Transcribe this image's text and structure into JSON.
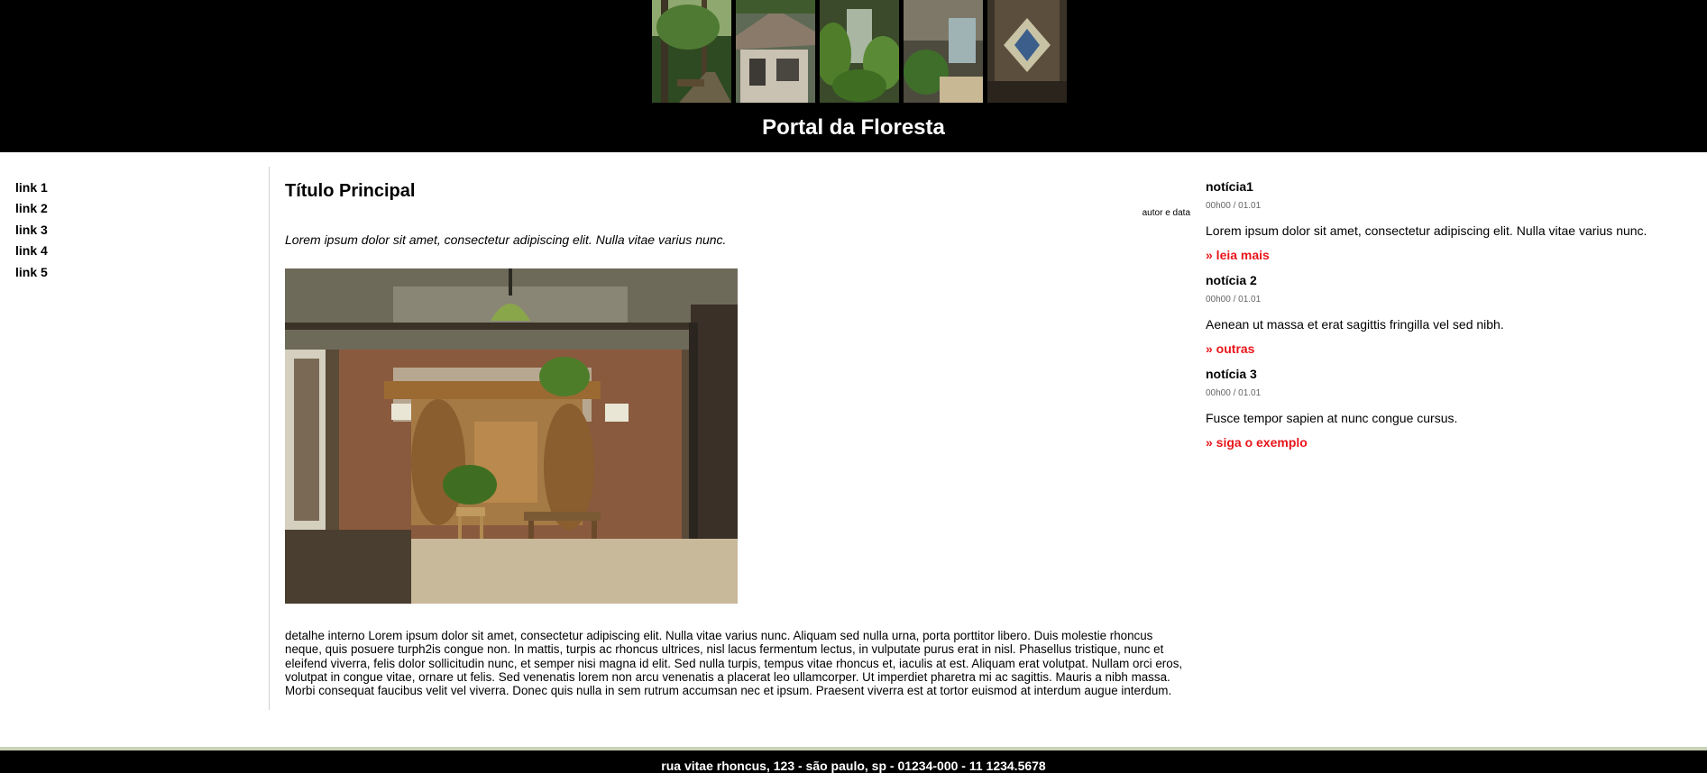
{
  "header": {
    "title": "Portal da Floresta"
  },
  "nav": {
    "links": [
      "link 1",
      "link 2",
      "link 3",
      "link 4",
      "link 5"
    ]
  },
  "article": {
    "title": "Título Principal",
    "author_date": "autor e data",
    "lead": "Lorem ipsum dolor sit amet, consectetur adipiscing elit. Nulla vitae varius nunc.",
    "body": "detalhe interno Lorem ipsum dolor sit amet, consectetur adipiscing elit. Nulla vitae varius nunc. Aliquam sed nulla urna, porta porttitor libero. Duis molestie rhoncus neque, quis posuere turph2is congue non. In mattis, turpis ac rhoncus ultrices, nisl lacus fermentum lectus, in vulputate purus erat in nisl. Phasellus tristique, nunc et eleifend viverra, felis dolor sollicitudin nunc, et semper nisi magna id elit. Sed nulla turpis, tempus vitae rhoncus et, iaculis at est. Aliquam erat volutpat. Nullam orci eros, volutpat in congue vitae, ornare ut felis. Sed venenatis lorem non arcu venenatis a placerat leo ullamcorper. Ut imperdiet pharetra mi ac sagittis. Mauris a nibh massa. Morbi consequat faucibus velit vel viverra. Donec quis nulla in sem rutrum accumsan nec et ipsum. Praesent viverra est at tortor euismod at interdum augue interdum."
  },
  "news": [
    {
      "title": "notícia1",
      "date": "00h00 / 01.01",
      "text": "Lorem ipsum dolor sit amet, consectetur adipiscing elit. Nulla vitae varius nunc.",
      "link": "» leia mais"
    },
    {
      "title": "notícia 2",
      "date": "00h00 / 01.01",
      "text": "Aenean ut massa et erat sagittis fringilla vel sed nibh.",
      "link": "» outras"
    },
    {
      "title": "notícia 3",
      "date": "00h00 / 01.01",
      "text": "Fusce tempor sapien at nunc congue cursus.",
      "link": "» siga o exemplo"
    }
  ],
  "footer": {
    "address": "rua vitae rhoncus, 123 - são paulo, sp - 01234-000 - 11 1234.5678"
  },
  "colors": {
    "link_red": "#e8161b",
    "header_bg": "#000000",
    "footer_line": "#c9d3b8"
  }
}
